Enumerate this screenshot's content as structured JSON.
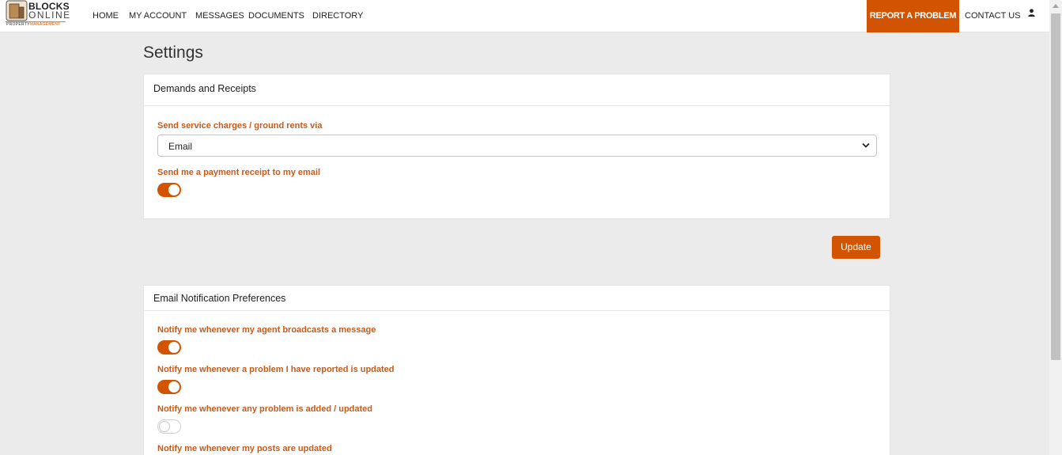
{
  "logo": {
    "line1": "BLOCKS",
    "line2": "ONLINE",
    "tag_a": "PROPERTY",
    "tag_b": "MANAGEMENT"
  },
  "nav": {
    "items": [
      "HOME",
      "MY ACCOUNT",
      "MESSAGES",
      "DOCUMENTS",
      "DIRECTORY"
    ],
    "report": "REPORT A PROBLEM",
    "contact": "CONTACT US"
  },
  "page": {
    "title": "Settings"
  },
  "demands": {
    "heading": "Demands and Receipts",
    "send_label": "Send service charges / ground rents via",
    "send_value": "Email",
    "receipt_label": "Send me a payment receipt to my email",
    "receipt_on": true
  },
  "update_label": "Update",
  "email_prefs": {
    "heading": "Email Notification Preferences",
    "items": [
      {
        "label": "Notify me whenever my agent broadcasts a message",
        "on": true
      },
      {
        "label": "Notify me whenever a problem I have reported is updated",
        "on": true
      },
      {
        "label": "Notify me whenever any problem is added / updated",
        "on": false
      },
      {
        "label": "Notify me whenever my posts are updated",
        "on": null
      }
    ]
  },
  "colors": {
    "accent": "#d35400",
    "label": "#c85a1a"
  },
  "icons": {
    "user": "user-icon",
    "chevron": "chevron-down-icon",
    "logo": "building-logo-icon"
  }
}
